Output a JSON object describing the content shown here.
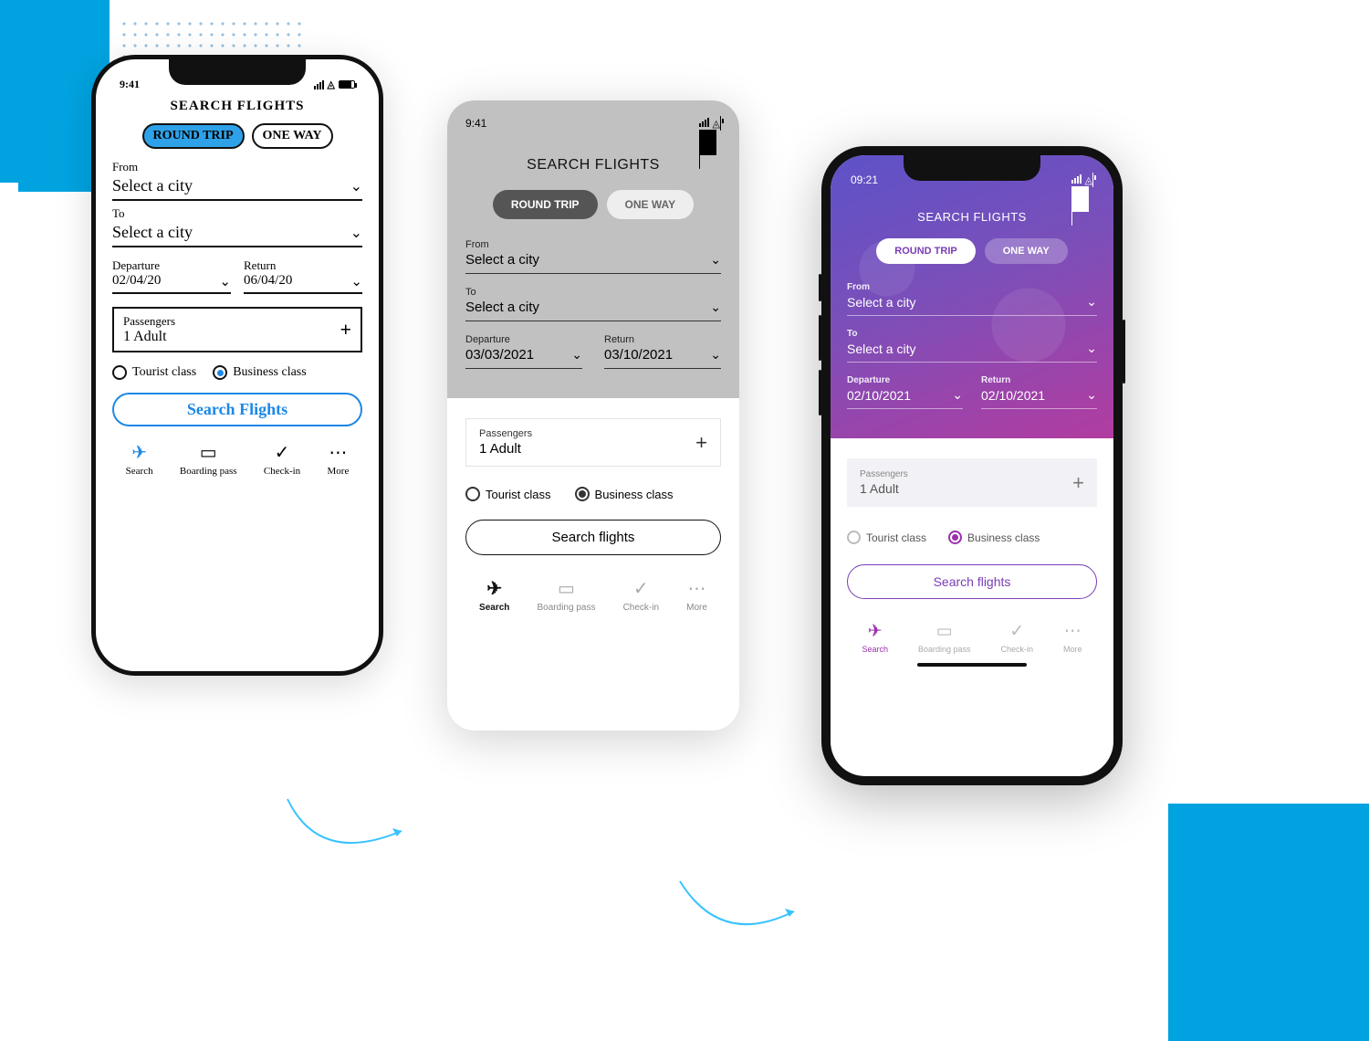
{
  "sketch": {
    "status_time": "9:41",
    "title": "SEARCH FLIGHTS",
    "pill_round": "ROUND TRIP",
    "pill_one": "ONE WAY",
    "from_label": "From",
    "from_value": "Select a city",
    "to_label": "To",
    "to_value": "Select a city",
    "dep_label": "Departure",
    "dep_value": "02/04/20",
    "ret_label": "Return",
    "ret_value": "06/04/20",
    "pax_label": "Passengers",
    "pax_value": "1 Adult",
    "radio_tourist": "Tourist class",
    "radio_business": "Business class",
    "search_btn": "Search Flights",
    "nav_search": "Search",
    "nav_boarding": "Boarding pass",
    "nav_checkin": "Check-in",
    "nav_more": "More"
  },
  "wire": {
    "status_time": "9:41",
    "title": "SEARCH FLIGHTS",
    "pill_round": "ROUND TRIP",
    "pill_one": "ONE WAY",
    "from_label": "From",
    "from_value": "Select a city",
    "to_label": "To",
    "to_value": "Select a city",
    "dep_label": "Departure",
    "dep_value": "03/03/2021",
    "ret_label": "Return",
    "ret_value": "03/10/2021",
    "pax_label": "Passengers",
    "pax_value": "1 Adult",
    "radio_tourist": "Tourist class",
    "radio_business": "Business class",
    "search_btn": "Search flights",
    "nav_search": "Search",
    "nav_boarding": "Boarding pass",
    "nav_checkin": "Check-in",
    "nav_more": "More"
  },
  "hifi": {
    "status_time": "09:21",
    "title": "SEARCH FLIGHTS",
    "pill_round": "ROUND TRIP",
    "pill_one": "ONE WAY",
    "from_label": "From",
    "from_value": "Select a city",
    "to_label": "To",
    "to_value": "Select a city",
    "dep_label": "Departure",
    "dep_value": "02/10/2021",
    "ret_label": "Return",
    "ret_value": "02/10/2021",
    "pax_label": "Passengers",
    "pax_value": "1 Adult",
    "radio_tourist": "Tourist class",
    "radio_business": "Business class",
    "search_btn": "Search flights",
    "nav_search": "Search",
    "nav_boarding": "Boarding pass",
    "nav_checkin": "Check-in",
    "nav_more": "More"
  }
}
